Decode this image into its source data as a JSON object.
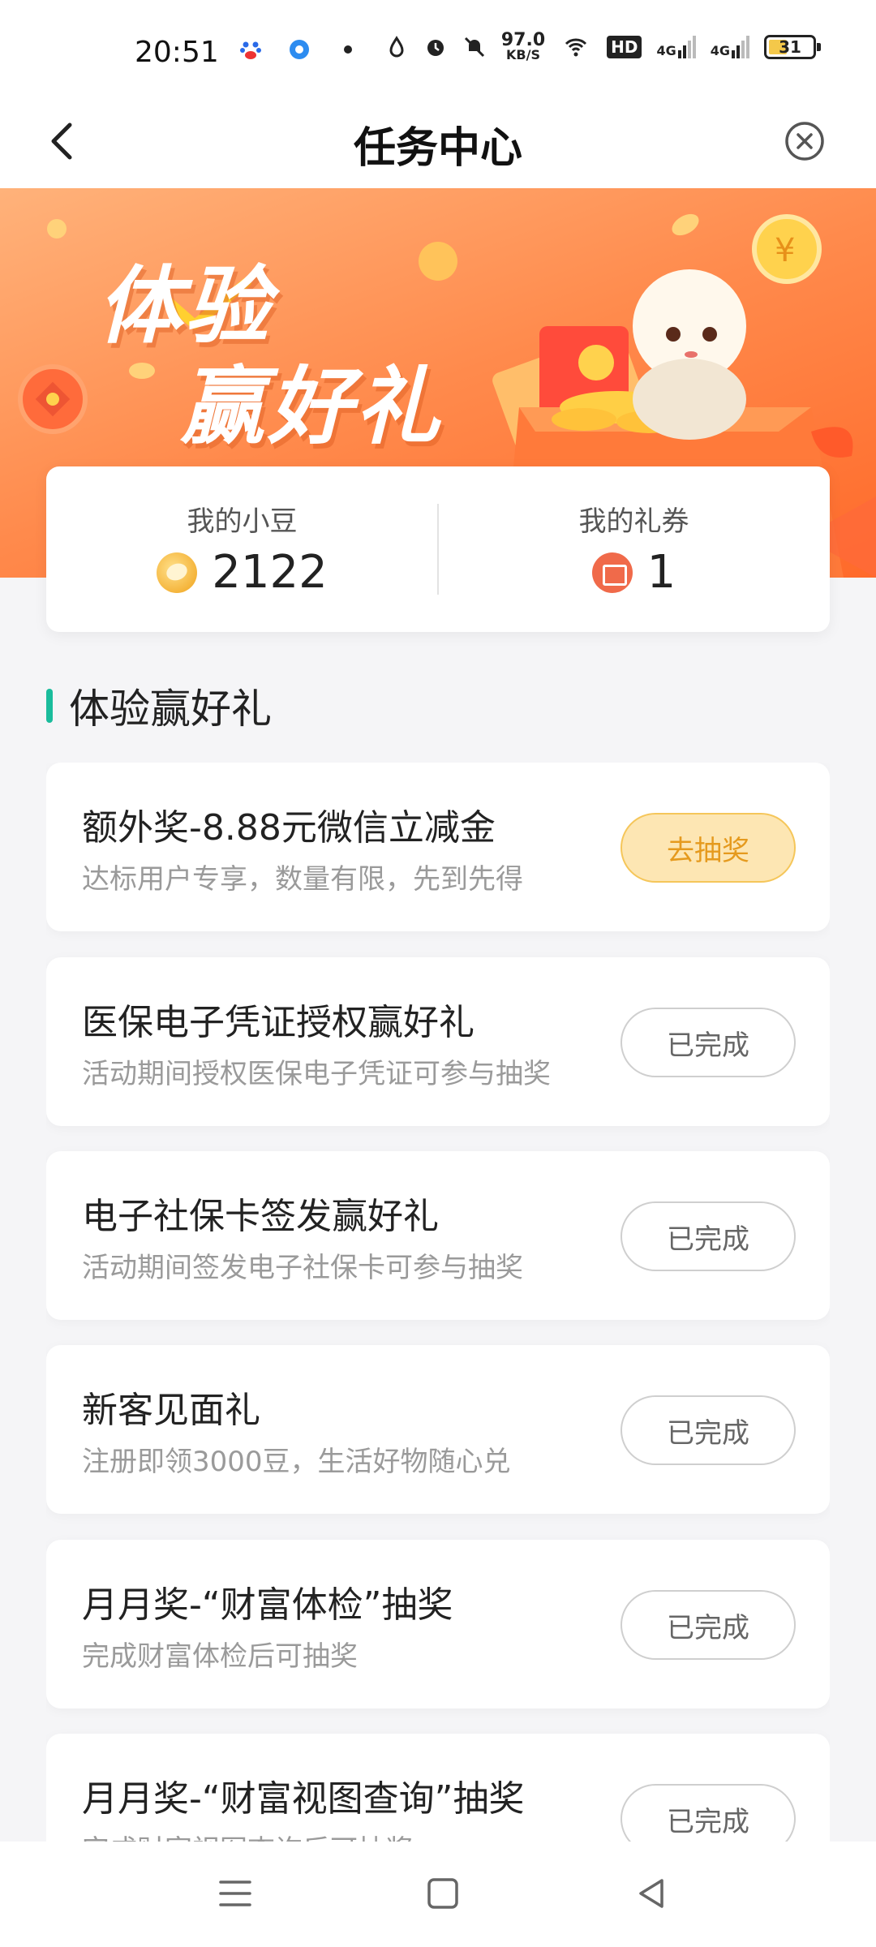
{
  "status_bar": {
    "time": "20:51",
    "net_speed_value": "97.0",
    "net_speed_unit": "KB/S",
    "battery_level": "31",
    "network_labels": [
      "4G",
      "4G"
    ],
    "hd_label": "HD"
  },
  "nav": {
    "title": "任务中心"
  },
  "banner": {
    "headline_line1": "体验",
    "headline_line2": "赢好礼"
  },
  "summary": {
    "beans_label": "我的小豆",
    "beans_value": "2122",
    "coupons_label": "我的礼券",
    "coupons_value": "1"
  },
  "section": {
    "title": "体验赢好礼"
  },
  "tasks": [
    {
      "name": "额外奖-8.88元微信立减金",
      "desc": "达标用户专享，数量有限，先到先得",
      "button": "去抽奖",
      "state": "primary"
    },
    {
      "name": "医保电子凭证授权赢好礼",
      "desc": "活动期间授权医保电子凭证可参与抽奖",
      "button": "已完成",
      "state": "done"
    },
    {
      "name": "电子社保卡签发赢好礼",
      "desc": "活动期间签发电子社保卡可参与抽奖",
      "button": "已完成",
      "state": "done"
    },
    {
      "name": "新客见面礼",
      "desc": "注册即领3000豆，生活好物随心兑",
      "button": "已完成",
      "state": "done"
    },
    {
      "name": "月月奖-“财富体检”抽奖",
      "desc": "完成财富体检后可抽奖",
      "button": "已完成",
      "state": "done"
    },
    {
      "name": "月月奖-“财富视图查询”抽奖",
      "desc": "完成财富视图查询后可抽奖",
      "button": "已完成",
      "state": "done"
    }
  ],
  "colors": {
    "accent_green": "#1abc9c",
    "banner_orange": "#ff8a4c",
    "primary_button_bg": "#fde6b3",
    "primary_button_text": "#e59a1e"
  }
}
